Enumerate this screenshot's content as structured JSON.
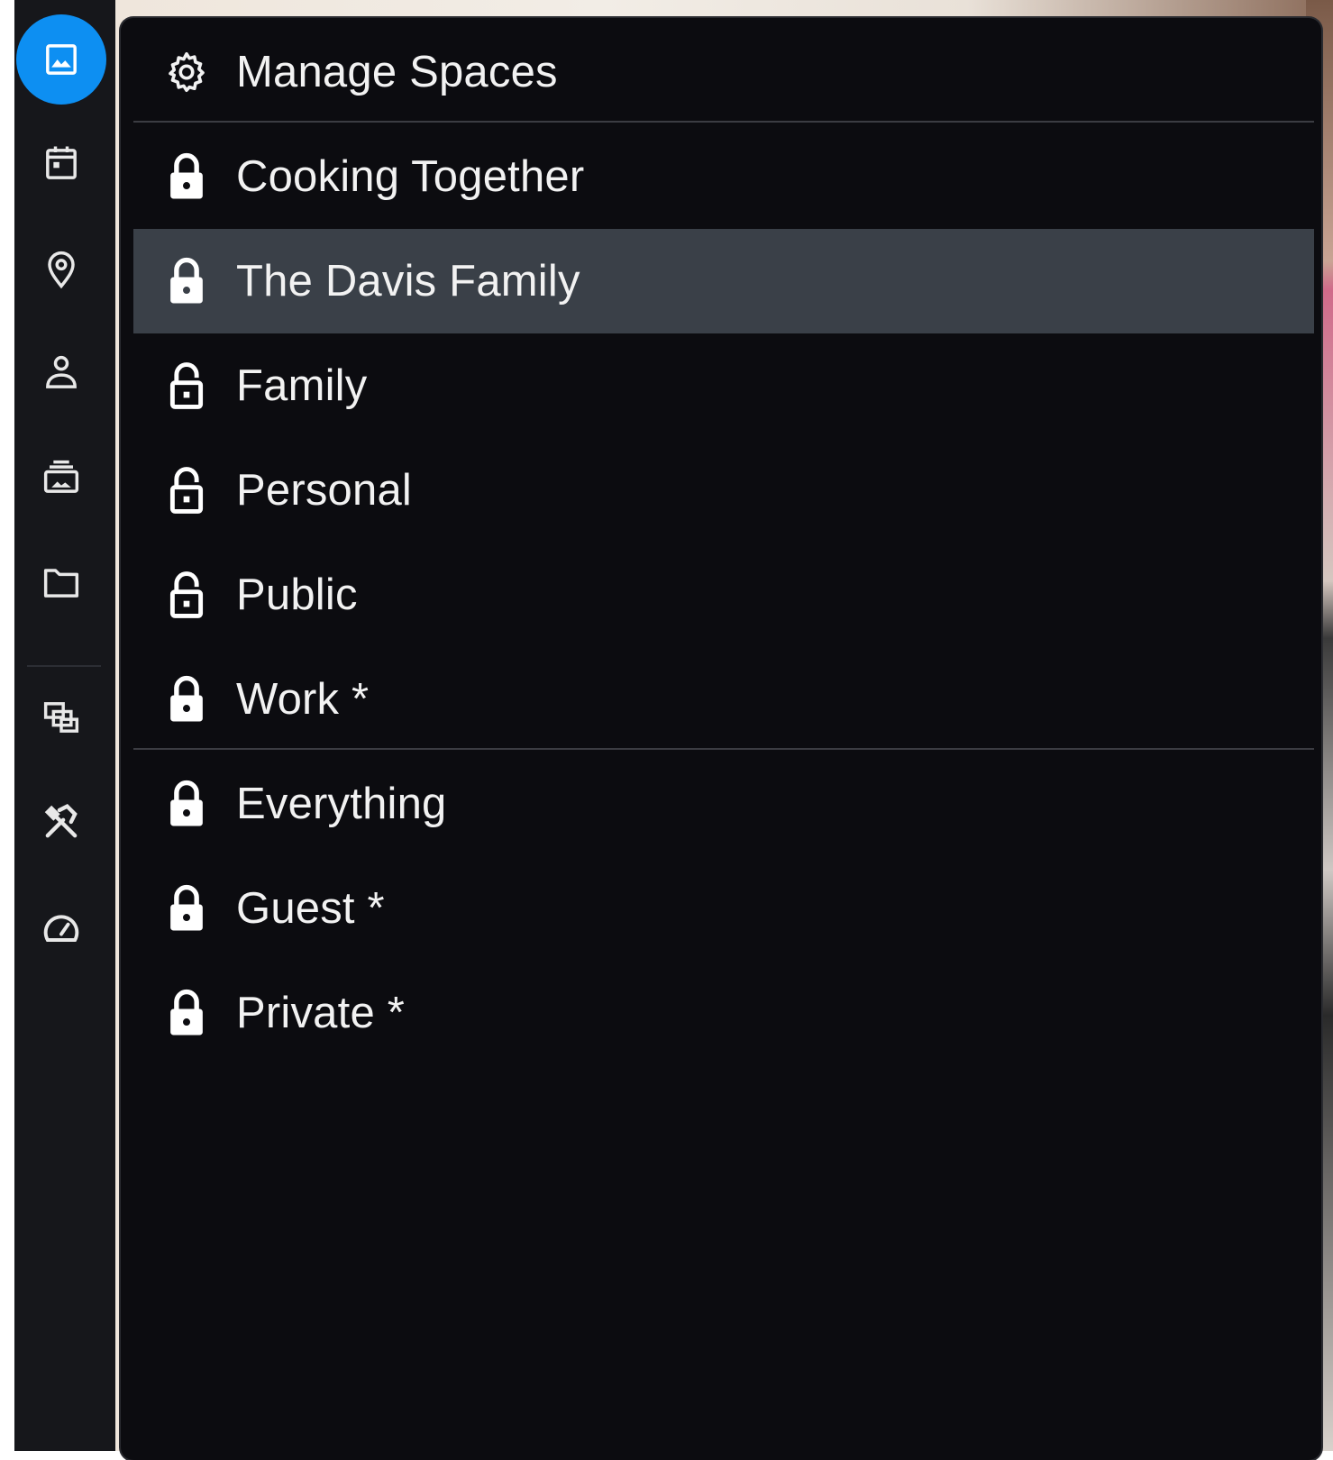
{
  "sidebar": {
    "items": [
      {
        "icon": "photos-icon",
        "active": true
      },
      {
        "icon": "calendar-icon"
      },
      {
        "icon": "map-pin-icon"
      },
      {
        "icon": "person-icon"
      },
      {
        "icon": "album-icon"
      },
      {
        "icon": "folder-icon"
      },
      {
        "icon": "library-icon"
      },
      {
        "icon": "tools-icon"
      },
      {
        "icon": "speedometer-icon"
      }
    ],
    "accent_color": "#0d8ff2"
  },
  "menu": {
    "manage": {
      "label": "Manage Spaces",
      "icon": "gear-icon"
    },
    "spaces": [
      {
        "label": "Cooking Together",
        "icon": "lock-icon",
        "selected": false
      },
      {
        "label": "The Davis Family",
        "icon": "lock-icon",
        "selected": true
      },
      {
        "label": "Family",
        "icon": "lock-open-icon",
        "selected": false
      },
      {
        "label": "Personal",
        "icon": "lock-open-icon",
        "selected": false
      },
      {
        "label": "Public",
        "icon": "lock-open-icon",
        "selected": false
      },
      {
        "label": "Work *",
        "icon": "lock-icon",
        "selected": false
      }
    ],
    "system_spaces": [
      {
        "label": "Everything",
        "icon": "lock-icon"
      },
      {
        "label": "Guest *",
        "icon": "lock-icon"
      },
      {
        "label": "Private *",
        "icon": "lock-icon"
      }
    ],
    "selected_bg": "#3a4048"
  }
}
